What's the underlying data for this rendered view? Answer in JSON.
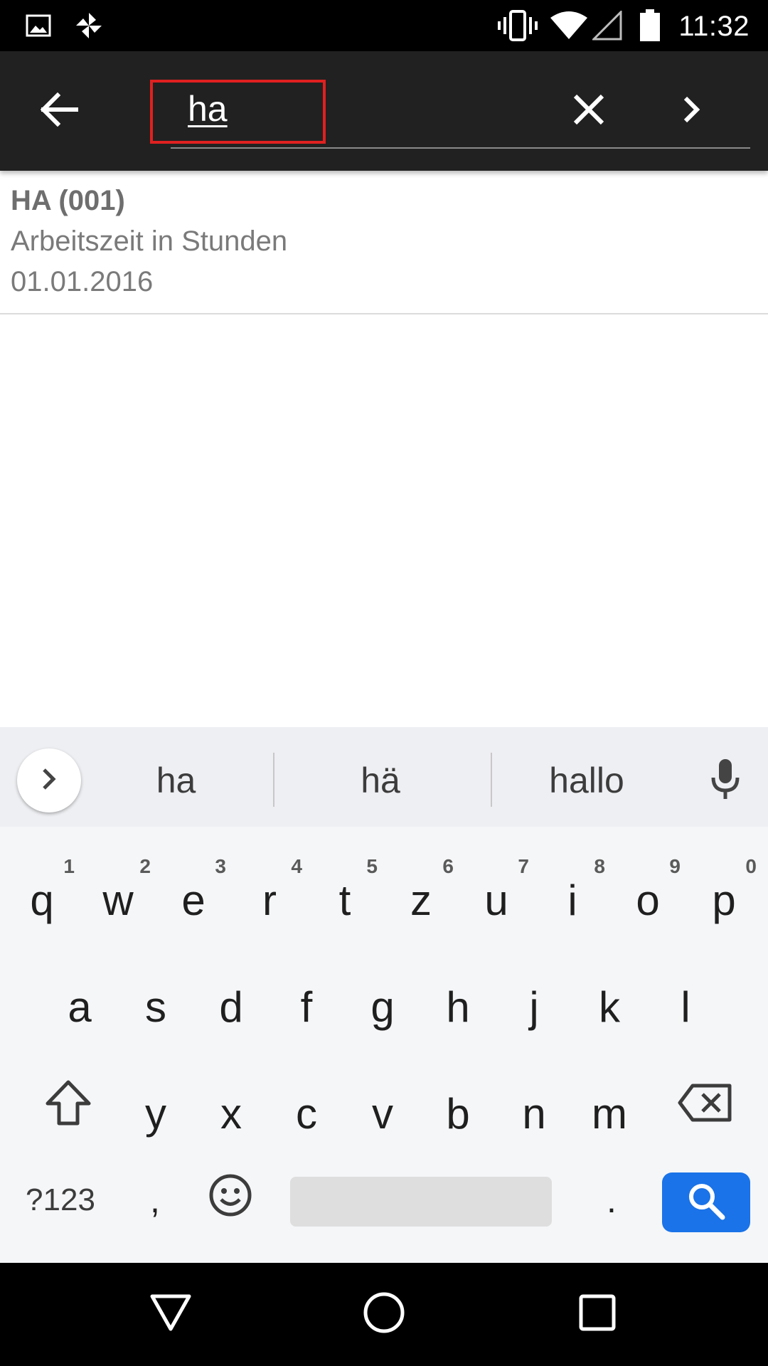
{
  "status_bar": {
    "time": "11:32",
    "icons": [
      "image-icon",
      "pinwheel-icon",
      "vibrate-icon",
      "wifi-icon",
      "cell-signal-icon",
      "battery-icon"
    ]
  },
  "toolbar": {
    "search_value": "ha",
    "icons": [
      "back-arrow-icon",
      "close-icon",
      "chevron-right-icon"
    ],
    "highlight_color": "#e02020"
  },
  "results": [
    {
      "title": "HA (001)",
      "subtitle": "Arbeitszeit in Stunden",
      "date": "01.01.2016"
    }
  ],
  "keyboard": {
    "suggestions": [
      "ha",
      "hä",
      "hallo"
    ],
    "row1": [
      {
        "ch": "q",
        "hint": "1"
      },
      {
        "ch": "w",
        "hint": "2"
      },
      {
        "ch": "e",
        "hint": "3"
      },
      {
        "ch": "r",
        "hint": "4"
      },
      {
        "ch": "t",
        "hint": "5"
      },
      {
        "ch": "z",
        "hint": "6"
      },
      {
        "ch": "u",
        "hint": "7"
      },
      {
        "ch": "i",
        "hint": "8"
      },
      {
        "ch": "o",
        "hint": "9"
      },
      {
        "ch": "p",
        "hint": "0"
      }
    ],
    "row2": [
      "a",
      "s",
      "d",
      "f",
      "g",
      "h",
      "j",
      "k",
      "l"
    ],
    "row3": [
      "y",
      "x",
      "c",
      "v",
      "b",
      "n",
      "m"
    ],
    "symbols_label": "?123",
    "comma_label": ",",
    "period_label": ".",
    "action_color": "#1a73e8"
  },
  "nav_bar": {
    "icons": [
      "back-triangle-icon",
      "home-circle-icon",
      "recents-square-icon"
    ]
  }
}
